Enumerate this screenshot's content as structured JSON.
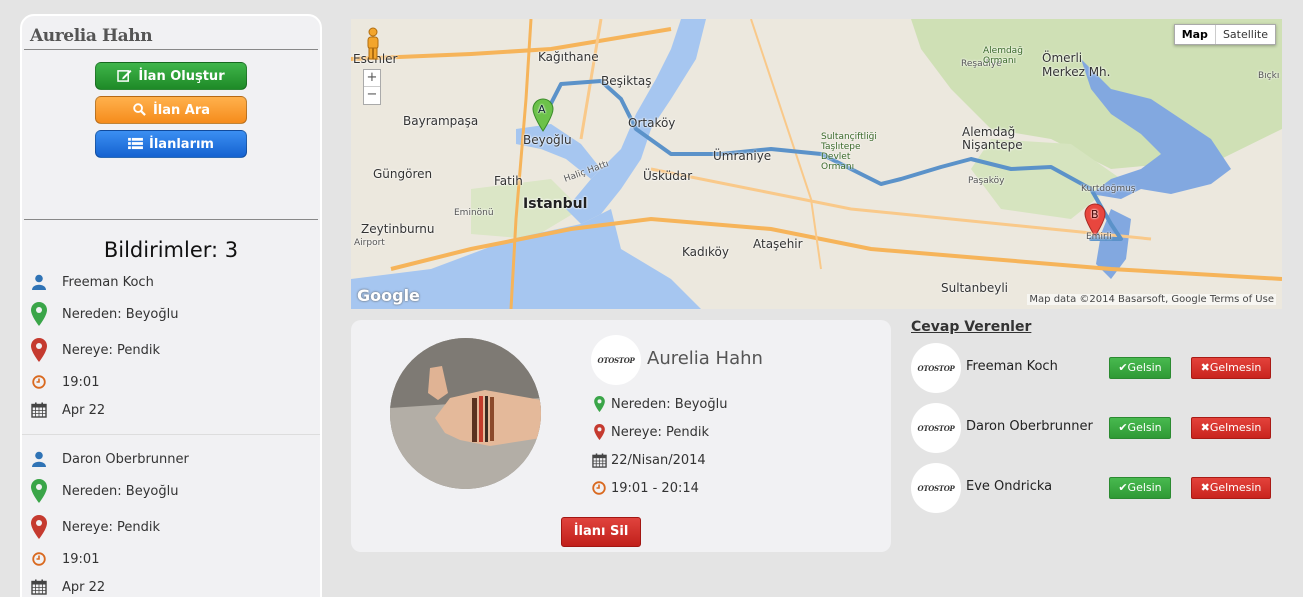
{
  "sidebar": {
    "user_name": "Aurelia Hahn",
    "buttons": {
      "create": {
        "label": "İlan Oluştur",
        "icon": "edit-icon",
        "color": "#2fa538"
      },
      "search": {
        "label": "İlan Ara",
        "icon": "search-icon",
        "color": "#f79a2e"
      },
      "mine": {
        "label": "İlanlarım",
        "icon": "list-icon",
        "color": "#2578e0"
      }
    },
    "notifications_title": "Bildirimler: 3",
    "notifications": [
      {
        "name": "Freeman Koch",
        "from": "Nereden: Beyoğlu",
        "to": "Nereye: Pendik",
        "time": "19:01",
        "date": "Apr 22"
      },
      {
        "name": "Daron Oberbrunner",
        "from": "Nereden: Beyoğlu",
        "to": "Nereye: Pendik",
        "time": "19:01",
        "date": "Apr 22"
      }
    ]
  },
  "map": {
    "toggle": {
      "map": "Map",
      "satellite": "Satellite"
    },
    "zoom_in": "+",
    "zoom_out": "−",
    "google": "Google",
    "attribution": "Map data ©2014 Basarsoft, Google   Terms of Use",
    "marker_a": "A",
    "marker_b": "B",
    "labels": {
      "esenler": "Esenler",
      "kagithane": "Kağıthane",
      "besiktas": "Beşiktaş",
      "bayrampasa": "Bayrampaşa",
      "beyoglu": "Beyoğlu",
      "ortakoy": "Ortaköy",
      "umraniye": "Ümraniye",
      "alemdag": "Alemdağ Nişantepe",
      "omerli": "Ömerli Merkez Mh.",
      "resadiye": "Reşadiye",
      "gungoren": "Güngören",
      "fatih": "Fatih",
      "uskudar": "Üsküdar",
      "pasakoy": "Paşaköy",
      "kurtdogmus": "Kurtdoğmuş",
      "istanbul": "Istanbul",
      "eminonu": "Eminönü",
      "zeytinburnu": "Zeytinburnu",
      "kadikoy": "Kadıköy",
      "atasehir": "Ataşehir",
      "sultanbeyli": "Sultanbeyli",
      "emirli": "Emirli",
      "airport": "Airport",
      "halic": "Haliç Hattı",
      "bicki": "Bıçkı",
      "sultanciftligi": "Sultançiftliği Taşlıtepe Devlet Ormanı",
      "alemdag_ormani": "Alemdağ Ormanı"
    }
  },
  "listing": {
    "owner_name": "Aurelia Hahn",
    "from": "Nereden: Beyoğlu",
    "to": "Nereye: Pendik",
    "date": "22/Nisan/2014",
    "time": "19:01 - 20:14",
    "delete_label": "İlanı Sil",
    "logo_text": "OTOSTOP"
  },
  "responders": {
    "title": "Cevap Verenler",
    "yes_label": "Gelsin",
    "no_label": "Gelmesin",
    "items": [
      {
        "name": "Freeman Koch"
      },
      {
        "name": "Daron Oberbrunner"
      },
      {
        "name": "Eve Ondricka"
      }
    ]
  }
}
